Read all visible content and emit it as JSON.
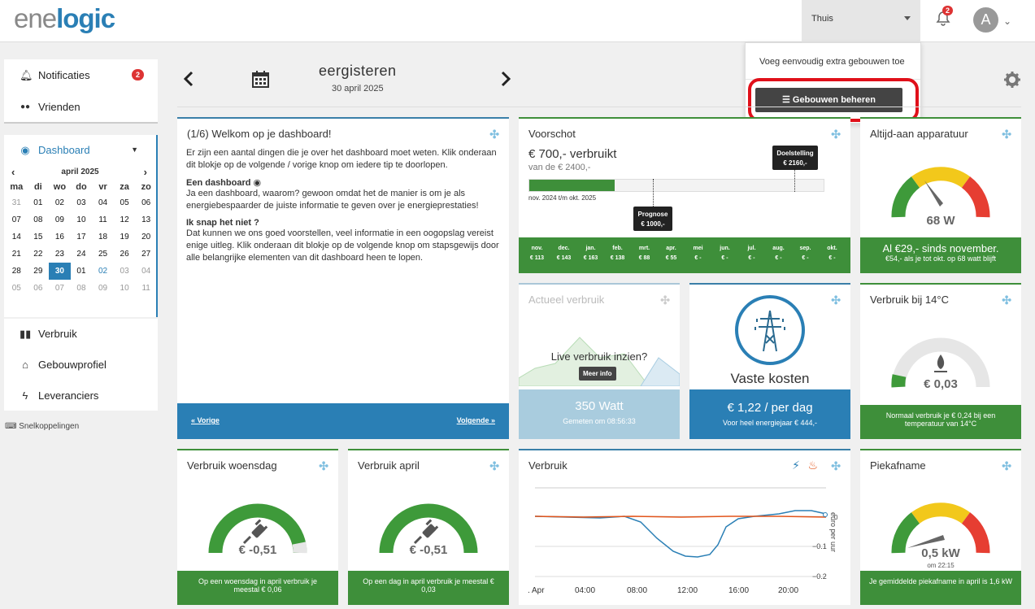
{
  "header": {
    "logo_part1": "ene",
    "logo_part2": "logic",
    "building": "Thuis",
    "notif_count": "2",
    "avatar": "A"
  },
  "dropdown": {
    "text": "Voeg eenvoudig extra gebouwen toe",
    "button": "Gebouwen beheren"
  },
  "sidebar": {
    "notificaties": "Notificaties",
    "notif_count": "2",
    "vrienden": "Vrienden",
    "dashboard": "Dashboard",
    "verbruik": "Verbruik",
    "gebouwprofiel": "Gebouwprofiel",
    "leveranciers": "Leveranciers",
    "snelkoppelingen": "Snelkoppelingen"
  },
  "calendar": {
    "month": "april 2025",
    "days": [
      "ma",
      "di",
      "wo",
      "do",
      "vr",
      "za",
      "zo"
    ],
    "weeks": [
      [
        "31",
        "01",
        "02",
        "03",
        "04",
        "05",
        "06"
      ],
      [
        "07",
        "08",
        "09",
        "10",
        "11",
        "12",
        "13"
      ],
      [
        "14",
        "15",
        "16",
        "17",
        "18",
        "19",
        "20"
      ],
      [
        "21",
        "22",
        "23",
        "24",
        "25",
        "26",
        "27"
      ],
      [
        "28",
        "29",
        "30",
        "01",
        "02",
        "03",
        "04"
      ],
      [
        "05",
        "06",
        "07",
        "08",
        "09",
        "10",
        "11"
      ]
    ]
  },
  "date": {
    "title": "eergisteren",
    "sub": "30 april 2025"
  },
  "welcome": {
    "title": "(1/6) Welkom op je dashboard!",
    "p1": "Er zijn een aantal dingen die je over het dashboard moet weten. Klik onderaan dit blokje op de volgende / vorige knop om iedere tip te doorlopen.",
    "h2": "Een dashboard",
    "p2": "Ja een dashboard, waarom? gewoon omdat het de manier is om je als energiebespaarder de juiste informatie te geven over je energieprestaties!",
    "h3": "Ik snap het niet ?",
    "p3": "Dat kunnen we ons goed voorstellen, veel informatie in een oogopslag vereist enige uitleg. Klik onderaan dit blokje op de volgende knop om stapsgewijs door alle belangrijke elementen van dit dashboard heen te lopen.",
    "prev": "« Vorige",
    "next": "Volgende »"
  },
  "voorschot": {
    "title": "Voorschot",
    "amount": "€ 700,- verbruikt",
    "of": "van de € 2400,-",
    "doel_label": "Doelstelling",
    "doel_value": "€ 2160,-",
    "prog_label": "Prognose",
    "prog_value": "€ 1000,-",
    "period": "nov. 2024 t/m okt. 2025",
    "progress_fraction": 0.29,
    "months": [
      "nov.",
      "dec.",
      "jan.",
      "feb.",
      "mrt.",
      "apr.",
      "mei",
      "jun.",
      "jul.",
      "aug.",
      "sep.",
      "okt."
    ],
    "values": [
      "€ 113",
      "€ 143",
      "€ 163",
      "€ 138",
      "€ 88",
      "€ 55",
      "€ -",
      "€ -",
      "€ -",
      "€ -",
      "€ -",
      "€ -"
    ]
  },
  "altijd": {
    "title": "Altijd-aan apparatuur",
    "value": "68 W",
    "line1": "Al €29,- sinds november.",
    "line2": "€54,- als je tot okt. op 68 watt blijft"
  },
  "actueel": {
    "title": "Actueel verbruik",
    "cta": "Live verbruik inzien?",
    "info": "Meer info",
    "watt": "350 Watt",
    "time": "Gemeten om 08:56:33"
  },
  "vaste": {
    "label": "Vaste kosten",
    "value": "€ 1,22 / per dag",
    "sub": "Voor heel energiejaar € 444,-"
  },
  "temp": {
    "title": "Verbruik bij 14°C",
    "value": "€ 0,03",
    "footer": "Normaal verbruik je € 0,24 bij een temperatuur van 14°C"
  },
  "woensdag": {
    "title": "Verbruik woensdag",
    "value": "€ -0,51",
    "footer": "Op een woensdag in april verbruik je meestal € 0,06"
  },
  "april": {
    "title": "Verbruik april",
    "value": "€ -0,51",
    "footer": "Op een dag in april verbruik je meestal € 0,03"
  },
  "verbruik": {
    "title": "Verbruik",
    "ylabel": "euro per uur",
    "yticks": [
      "0",
      "−0.1",
      "−0.2"
    ],
    "xticks": [
      ". Apr",
      "04:00",
      "08:00",
      "12:00",
      "16:00",
      "20:00"
    ]
  },
  "piek": {
    "title": "Piekafname",
    "value": "0,5 kW",
    "time": "om 22:15",
    "footer": "Je gemiddelde piekafname in april is 1,6 kW"
  }
}
